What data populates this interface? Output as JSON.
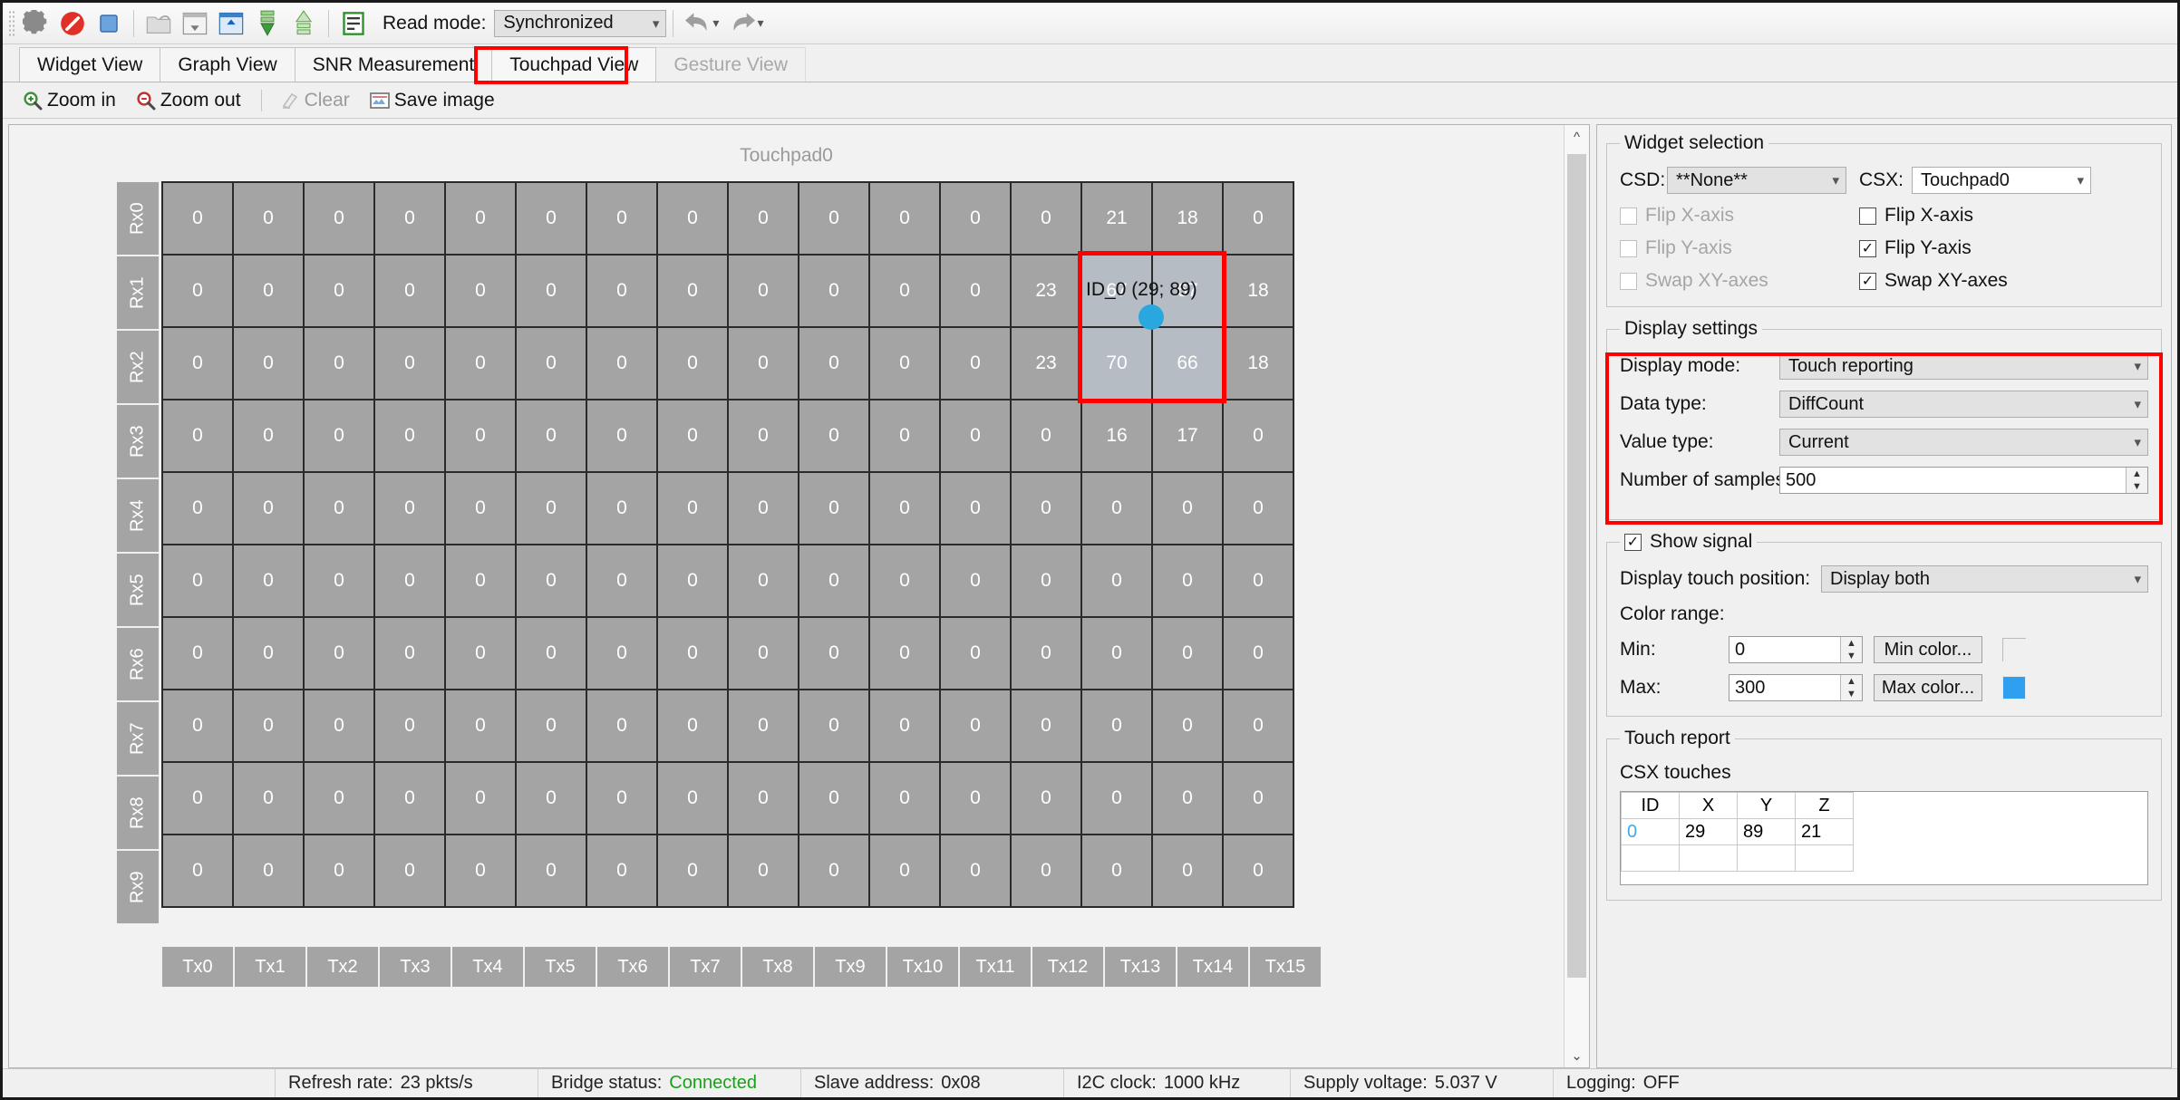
{
  "toolbar": {
    "icons": [
      {
        "name": "settings-gear-icon",
        "title": "Settings"
      },
      {
        "name": "disconnect-icon",
        "title": "Disconnect"
      },
      {
        "name": "stop-icon",
        "title": "Stop"
      },
      {
        "name": "open-file-icon",
        "title": "Open"
      },
      {
        "name": "read-from-device-icon",
        "title": "Read"
      },
      {
        "name": "write-to-device-icon",
        "title": "Write"
      },
      {
        "name": "apply-down-icon",
        "title": "Apply"
      },
      {
        "name": "restore-up-icon",
        "title": "Restore"
      },
      {
        "name": "log-icon",
        "title": "Log"
      }
    ],
    "read_mode_label": "Read mode:",
    "read_mode_value": "Synchronized",
    "undo_label": "Undo",
    "redo_label": "Redo"
  },
  "tabs": [
    {
      "label": "Widget View",
      "state": "normal"
    },
    {
      "label": "Graph View",
      "state": "normal"
    },
    {
      "label": "SNR Measurement",
      "state": "normal"
    },
    {
      "label": "Touchpad View",
      "state": "active"
    },
    {
      "label": "Gesture View",
      "state": "disabled"
    }
  ],
  "subbar": [
    {
      "label": "Zoom in",
      "icon": "zoom-in-icon",
      "disabled": false
    },
    {
      "label": "Zoom out",
      "icon": "zoom-out-icon",
      "disabled": false
    },
    {
      "label": "Clear",
      "icon": "clear-icon",
      "disabled": true
    },
    {
      "label": "Save image",
      "icon": "save-image-icon",
      "disabled": false
    }
  ],
  "canvas": {
    "title": "Touchpad0",
    "touch_label": "ID_0 (29; 89)"
  },
  "chart_data": {
    "type": "heatmap",
    "title": "Touchpad0",
    "xlabel": "",
    "ylabel": "",
    "row_labels": [
      "Rx0",
      "Rx1",
      "Rx2",
      "Rx3",
      "Rx4",
      "Rx5",
      "Rx6",
      "Rx7",
      "Rx8",
      "Rx9"
    ],
    "col_labels": [
      "Tx0",
      "Tx1",
      "Tx2",
      "Tx3",
      "Tx4",
      "Tx5",
      "Tx6",
      "Tx7",
      "Tx8",
      "Tx9",
      "Tx10",
      "Tx11",
      "Tx12",
      "Tx13",
      "Tx14",
      "Tx15"
    ],
    "values": [
      [
        0,
        0,
        0,
        0,
        0,
        0,
        0,
        0,
        0,
        0,
        0,
        0,
        0,
        21,
        18,
        0
      ],
      [
        0,
        0,
        0,
        0,
        0,
        0,
        0,
        0,
        0,
        0,
        0,
        0,
        23,
        67,
        67,
        18
      ],
      [
        0,
        0,
        0,
        0,
        0,
        0,
        0,
        0,
        0,
        0,
        0,
        0,
        23,
        70,
        66,
        18
      ],
      [
        0,
        0,
        0,
        0,
        0,
        0,
        0,
        0,
        0,
        0,
        0,
        0,
        0,
        16,
        17,
        0
      ],
      [
        0,
        0,
        0,
        0,
        0,
        0,
        0,
        0,
        0,
        0,
        0,
        0,
        0,
        0,
        0,
        0
      ],
      [
        0,
        0,
        0,
        0,
        0,
        0,
        0,
        0,
        0,
        0,
        0,
        0,
        0,
        0,
        0,
        0
      ],
      [
        0,
        0,
        0,
        0,
        0,
        0,
        0,
        0,
        0,
        0,
        0,
        0,
        0,
        0,
        0,
        0
      ],
      [
        0,
        0,
        0,
        0,
        0,
        0,
        0,
        0,
        0,
        0,
        0,
        0,
        0,
        0,
        0,
        0
      ],
      [
        0,
        0,
        0,
        0,
        0,
        0,
        0,
        0,
        0,
        0,
        0,
        0,
        0,
        0,
        0,
        0
      ],
      [
        0,
        0,
        0,
        0,
        0,
        0,
        0,
        0,
        0,
        0,
        0,
        0,
        0,
        0,
        0,
        0
      ]
    ],
    "highlight_region": {
      "rows": [
        1,
        2
      ],
      "cols": [
        13,
        14
      ]
    },
    "touch_marker": {
      "label": "ID_0 (29; 89)",
      "x": 29,
      "y": 89,
      "color": "#29a8e0"
    },
    "color_min": 0,
    "color_max": 300,
    "max_color": "#2f9ff0"
  },
  "widget_selection": {
    "legend": "Widget selection",
    "csd_label": "CSD:",
    "csd_value": "**None**",
    "csx_label": "CSX:",
    "csx_value": "Touchpad0",
    "csd_options": [
      {
        "label": "Flip X-axis",
        "checked": false,
        "disabled": true
      },
      {
        "label": "Flip Y-axis",
        "checked": false,
        "disabled": true
      },
      {
        "label": "Swap XY-axes",
        "checked": false,
        "disabled": true
      }
    ],
    "csx_options": [
      {
        "label": "Flip X-axis",
        "checked": false,
        "disabled": false
      },
      {
        "label": "Flip Y-axis",
        "checked": true,
        "disabled": false
      },
      {
        "label": "Swap XY-axes",
        "checked": true,
        "disabled": false
      }
    ]
  },
  "display_settings": {
    "legend": "Display settings",
    "display_mode_label": "Display mode:",
    "display_mode_value": "Touch reporting",
    "data_type_label": "Data type:",
    "data_type_value": "DiffCount",
    "value_type_label": "Value type:",
    "value_type_value": "Current",
    "samples_label": "Number of samples:",
    "samples_value": "500"
  },
  "show_signal": {
    "legend": "Show signal",
    "checked": true,
    "touch_position_label": "Display touch position:",
    "touch_position_value": "Display both",
    "color_range_label": "Color range:",
    "min_label": "Min:",
    "min_value": "0",
    "min_button": "Min color...",
    "min_swatch": "#ffffff",
    "max_label": "Max:",
    "max_value": "300",
    "max_button": "Max color...",
    "max_swatch": "#2f9ff0"
  },
  "touch_report": {
    "legend": "Touch report",
    "subtitle": "CSX touches",
    "columns": [
      "ID",
      "X",
      "Y",
      "Z"
    ],
    "rows": [
      [
        "0",
        "29",
        "89",
        "21"
      ]
    ]
  },
  "status": [
    {
      "key": "Refresh rate:",
      "value": "23 pkts/s",
      "ok": false
    },
    {
      "key": "Bridge status:",
      "value": "Connected",
      "ok": true
    },
    {
      "key": "Slave address:",
      "value": "0x08",
      "ok": false
    },
    {
      "key": "I2C clock:",
      "value": "1000 kHz",
      "ok": false
    },
    {
      "key": "Supply voltage:",
      "value": "5.037 V",
      "ok": false
    },
    {
      "key": "Logging:",
      "value": "OFF",
      "ok": false
    }
  ]
}
